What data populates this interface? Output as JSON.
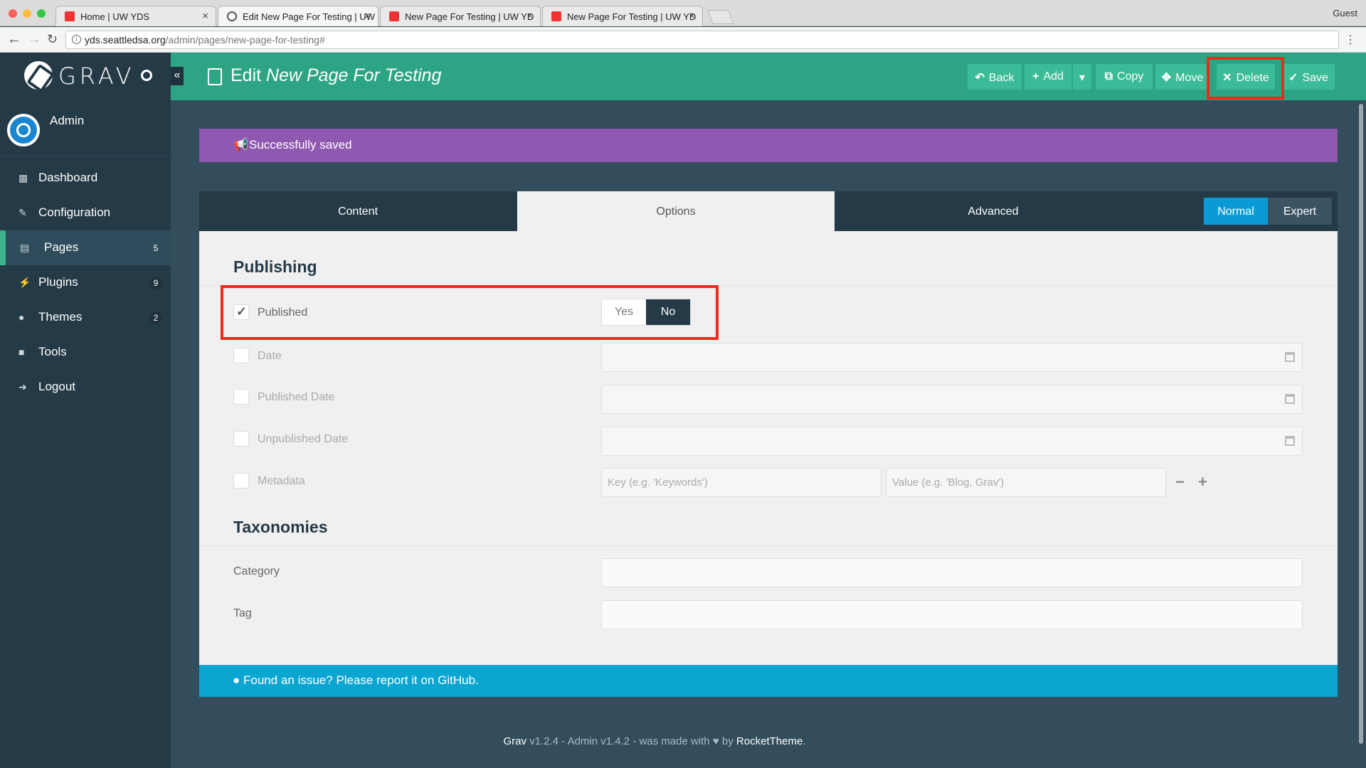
{
  "browser": {
    "tabs": [
      {
        "label": "Home | UW YDS"
      },
      {
        "label": "Edit New Page For Testing | UW"
      },
      {
        "label": "New Page For Testing | UW YD"
      },
      {
        "label": "New Page For Testing | UW YD"
      }
    ],
    "profile": "Guest",
    "url_host": "yds.seattledsa.org",
    "url_path": "/admin/pages/new-page-for-testing#"
  },
  "sidebar": {
    "logo_text": "GRAV",
    "user_name": "Admin",
    "items": [
      {
        "label": "Dashboard",
        "icon": "grid-icon"
      },
      {
        "label": "Configuration",
        "icon": "wrench-icon"
      },
      {
        "label": "Pages",
        "icon": "file-icon",
        "badge": "5"
      },
      {
        "label": "Plugins",
        "icon": "plug-icon",
        "badge": "9"
      },
      {
        "label": "Themes",
        "icon": "drop-icon",
        "badge": "2"
      },
      {
        "label": "Tools",
        "icon": "briefcase-icon"
      },
      {
        "label": "Logout",
        "icon": "sign-out-icon"
      }
    ]
  },
  "header": {
    "title_prefix": "Edit",
    "title_page": "New Page For Testing",
    "buttons": {
      "back": "Back",
      "add": "Add",
      "copy": "Copy",
      "move": "Move",
      "delete": "Delete",
      "save": "Save"
    }
  },
  "alert": {
    "message": "Successfully saved"
  },
  "tabs": {
    "content": "Content",
    "options": "Options",
    "advanced": "Advanced",
    "normal": "Normal",
    "expert": "Expert"
  },
  "publishing": {
    "heading": "Publishing",
    "published_label": "Published",
    "yes": "Yes",
    "no": "No",
    "date_label": "Date",
    "published_date_label": "Published Date",
    "unpublished_date_label": "Unpublished Date",
    "metadata_label": "Metadata",
    "key_placeholder": "Key (e.g. 'Keywords')",
    "value_placeholder": "Value (e.g. 'Blog, Grav')"
  },
  "taxonomies": {
    "heading": "Taxonomies",
    "category_label": "Category",
    "tag_label": "Tag"
  },
  "footer": {
    "issue_text": "Found an issue? Please report it on GitHub.",
    "grav": "Grav",
    "version_text": " v1.2.4 - Admin v1.4.2 - was made with ",
    "by": " by ",
    "rockettheme": "RocketTheme",
    "period": "."
  },
  "colors": {
    "header": "#2da584",
    "sidebar": "#253a47",
    "alert": "#8f58b1",
    "footer_bar": "#0aa5d1",
    "highlight": "#ee2a1b"
  }
}
